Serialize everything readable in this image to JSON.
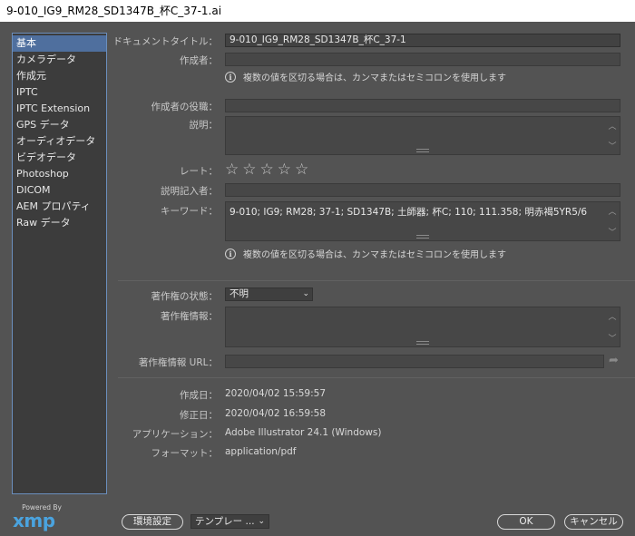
{
  "window": {
    "title": "9-010_IG9_RM28_SD1347B_杯C_37-1.ai"
  },
  "sidebar": {
    "items": [
      {
        "label": "基本",
        "selected": true
      },
      {
        "label": "カメラデータ"
      },
      {
        "label": "作成元"
      },
      {
        "label": "IPTC"
      },
      {
        "label": "IPTC Extension"
      },
      {
        "label": "GPS データ"
      },
      {
        "label": "オーディオデータ"
      },
      {
        "label": "ビデオデータ"
      },
      {
        "label": "Photoshop"
      },
      {
        "label": "DICOM"
      },
      {
        "label": "AEM プロパティ"
      },
      {
        "label": "Raw データ"
      }
    ]
  },
  "form": {
    "doc_title_label": "ドキュメントタイトル：",
    "doc_title_value": "9-010_IG9_RM28_SD1347B_杯C_37-1",
    "author_label": "作成者：",
    "author_value": "",
    "author_hint": "複数の値を区切る場合は、カンマまたはセミコロンを使用します",
    "author_role_label": "作成者の役職：",
    "author_role_value": "",
    "description_label": "説明：",
    "description_value": "",
    "rating_label": "レート：",
    "rating_value": 0,
    "rating_max": 5,
    "desc_writer_label": "説明記入者：",
    "desc_writer_value": "",
    "keywords_label": "キーワード：",
    "keywords_value": "9-010; IG9; RM28; 37-1; SD1347B; 土師器; 杯C; 110; 111.358; 明赤褐5YR5/6",
    "keywords_hint": "複数の値を区切る場合は、カンマまたはセミコロンを使用します",
    "copyright_status_label": "著作権の状態：",
    "copyright_status_value": "不明",
    "copyright_info_label": "著作権情報：",
    "copyright_info_value": "",
    "copyright_url_label": "著作権情報 URL：",
    "copyright_url_value": "",
    "created_label": "作成日：",
    "created_value": "2020/04/02 15:59:57",
    "modified_label": "修正日：",
    "modified_value": "2020/04/02 16:59:58",
    "application_label": "アプリケーション：",
    "application_value": "Adobe Illustrator 24.1 (Windows)",
    "format_label": "フォーマット：",
    "format_value": "application/pdf"
  },
  "footer": {
    "powered_by": "Powered By",
    "xmp_logo": "xmp",
    "settings_label": "環境設定",
    "template_label": "テンプレー ...",
    "ok_label": "OK",
    "cancel_label": "キャンセル"
  },
  "colors": {
    "background": "#535353",
    "sidebar_bg": "#3c3c3c",
    "selection": "#4f6f9e",
    "xmp_blue": "#4aa3df"
  }
}
